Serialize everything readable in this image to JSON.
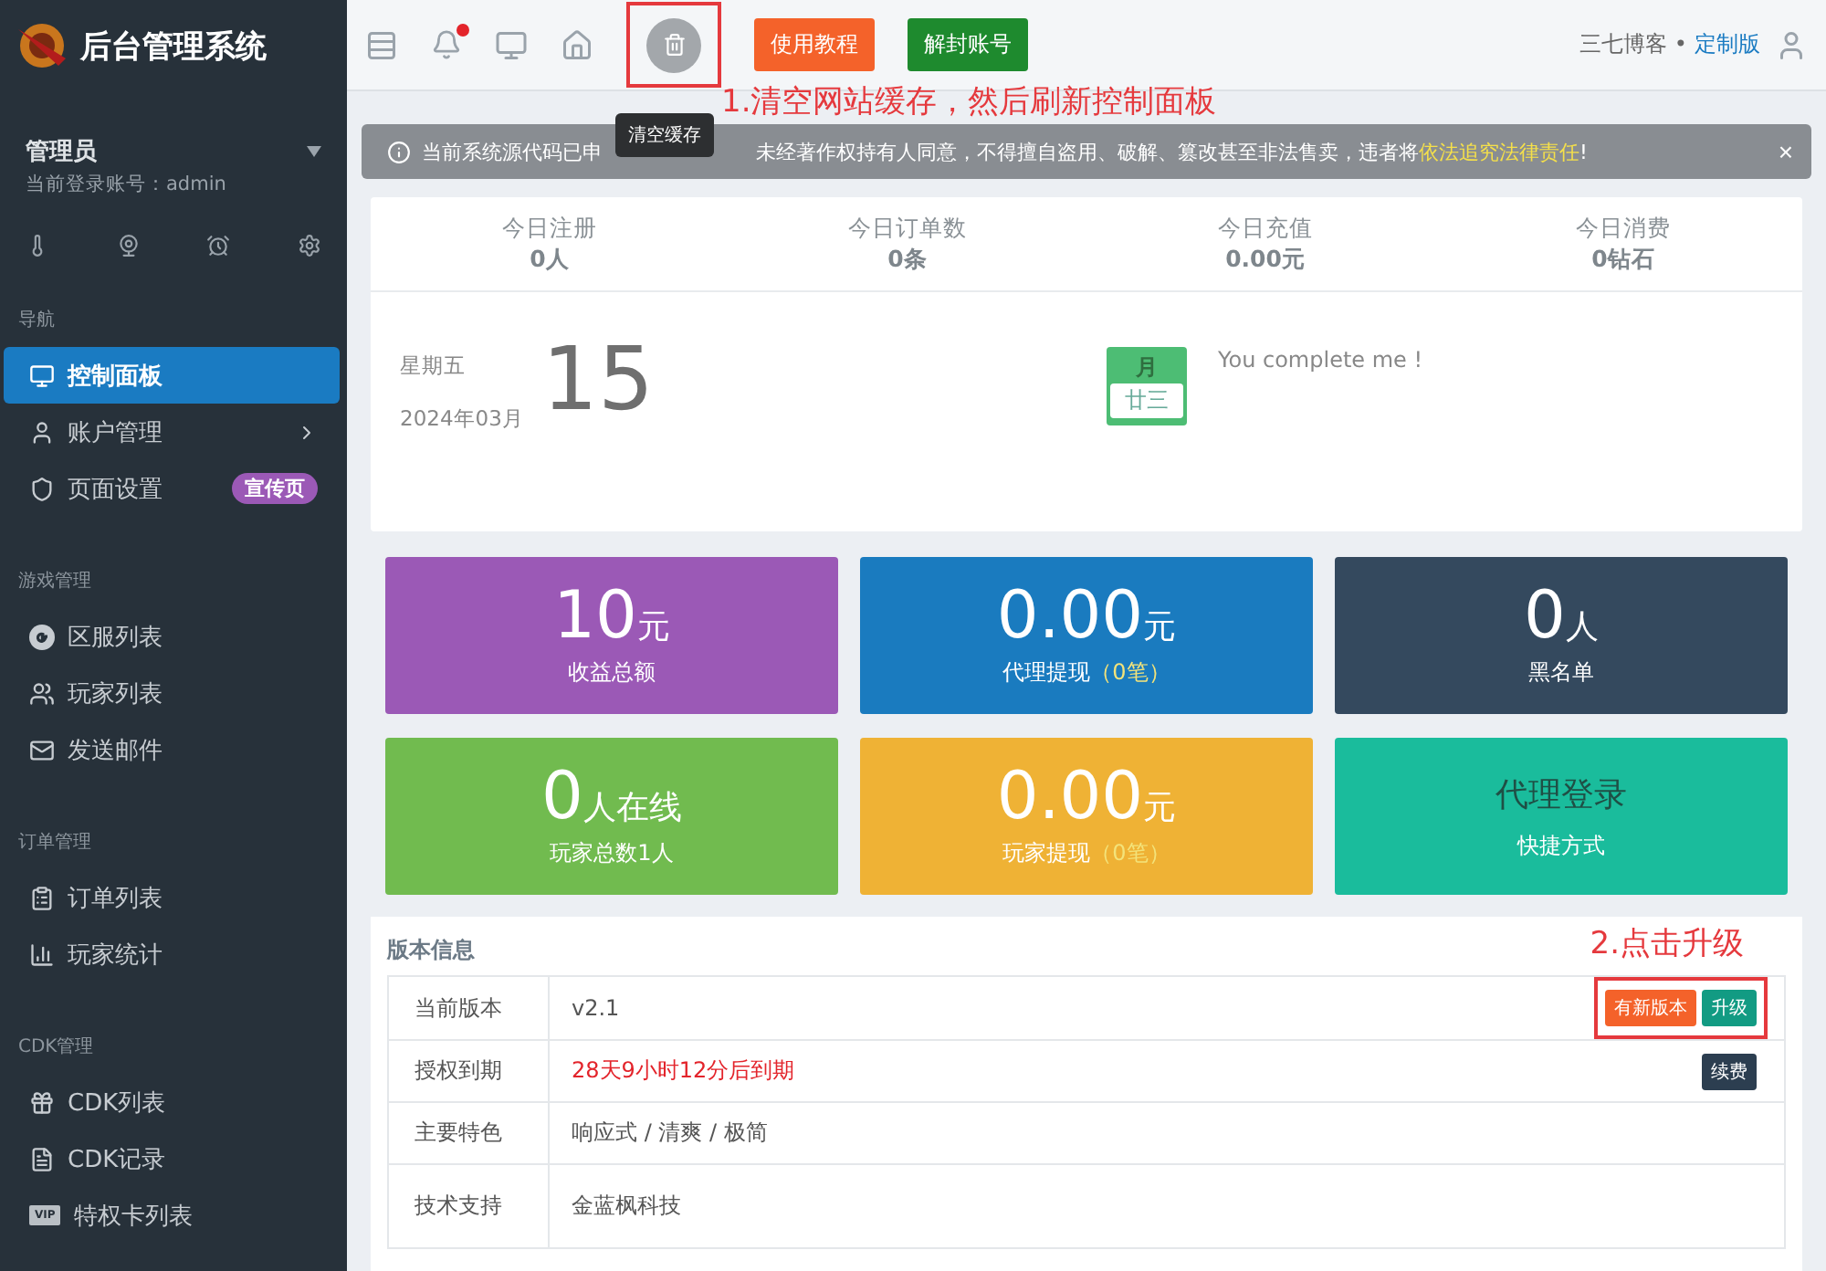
{
  "brand": {
    "title": "后台管理系统"
  },
  "user": {
    "name": "管理员",
    "account": "当前登录账号：admin"
  },
  "nav": [
    {
      "heading": "导航",
      "items": [
        {
          "label": "控制面板",
          "selected": true,
          "kind": "link"
        },
        {
          "label": "账户管理",
          "selected": false,
          "kind": "submenu"
        },
        {
          "label": "页面设置",
          "selected": false,
          "kind": "link",
          "badge": "宣传页"
        }
      ]
    },
    {
      "heading": "游戏管理",
      "items": [
        {
          "label": "区服列表",
          "selected": false,
          "kind": "link"
        },
        {
          "label": "玩家列表",
          "selected": false,
          "kind": "link"
        },
        {
          "label": "发送邮件",
          "selected": false,
          "kind": "link"
        }
      ]
    },
    {
      "heading": "订单管理",
      "items": [
        {
          "label": "订单列表",
          "selected": false,
          "kind": "link"
        },
        {
          "label": "玩家统计",
          "selected": false,
          "kind": "link"
        }
      ]
    },
    {
      "heading": "CDK管理",
      "items": [
        {
          "label": "CDK列表",
          "selected": false,
          "kind": "link"
        },
        {
          "label": "CDK记录",
          "selected": false,
          "kind": "link"
        },
        {
          "label": "特权卡列表",
          "selected": false,
          "kind": "link",
          "icon_label": "VIP"
        }
      ]
    }
  ],
  "topbar": {
    "unread": true,
    "tooltip": "清空缓存",
    "buttons": [
      {
        "label": "使用教程",
        "color": "#f4622a"
      },
      {
        "label": "解封账号",
        "color": "#1e8a2e"
      }
    ],
    "site": "三七博客 •",
    "edition": "定制版",
    "annotation": "1.清空网站缓存，然后刷新控制面板"
  },
  "alert": {
    "before": "当前系统源代码已申",
    "after": "未经著作权持有人同意，不得擅自盗用、破解、篡改甚至非法售卖，违者将",
    "highlight": "依法追究法律责任",
    "end": "!",
    "close": "×"
  },
  "today": [
    {
      "label": "今日注册",
      "value": "0人"
    },
    {
      "label": "今日订单数",
      "value": "0条"
    },
    {
      "label": "今日充值",
      "value": "0.00元"
    },
    {
      "label": "今日消费",
      "value": "0钻石"
    }
  ],
  "date": {
    "weekday": "星期五",
    "month": "2024年03月",
    "day": "15",
    "lunar_month": "月",
    "lunar_day": "廿三",
    "quote": "You complete me !"
  },
  "tiles": [
    {
      "value": "10",
      "unit": "元",
      "label": "收益总额",
      "color": "#9b59b6"
    },
    {
      "value": "0.00",
      "unit": "元",
      "label": "代理提现",
      "note": "（0笔）",
      "color": "#1a7bbf"
    },
    {
      "value": "0",
      "unit": "人",
      "label": "黑名单",
      "color": "#34495e"
    },
    {
      "value": "0",
      "unit": "人在线",
      "label": "玩家总数1人",
      "color": "#71bb4f"
    },
    {
      "value": "0.00",
      "unit": "元",
      "label": "玩家提现",
      "note": "（0笔）",
      "color": "#efb235"
    },
    {
      "title": "代理登录",
      "label": "快捷方式",
      "color": "#1abc9c"
    }
  ],
  "version": {
    "title": "版本信息",
    "annotation": "2.点击升级",
    "rows": [
      {
        "label": "当前版本",
        "value": "v2.1",
        "kind": "plain",
        "actions": [
          {
            "label": "有新版本",
            "color": "#f4622a"
          },
          {
            "label": "升级",
            "color": "#129b83"
          }
        ],
        "annotated": true
      },
      {
        "label": "授权到期",
        "value": "28天9小时12分后到期",
        "kind": "danger",
        "actions": [
          {
            "label": "续费",
            "color": "#2c3e50"
          }
        ],
        "annotated": false
      },
      {
        "label": "主要特色",
        "value": "响应式 / 清爽 / 极简",
        "kind": "plain",
        "annotated": false
      },
      {
        "label": "技术支持",
        "value": "金蓝枫科技",
        "kind": "plain",
        "annotated": false
      }
    ]
  }
}
